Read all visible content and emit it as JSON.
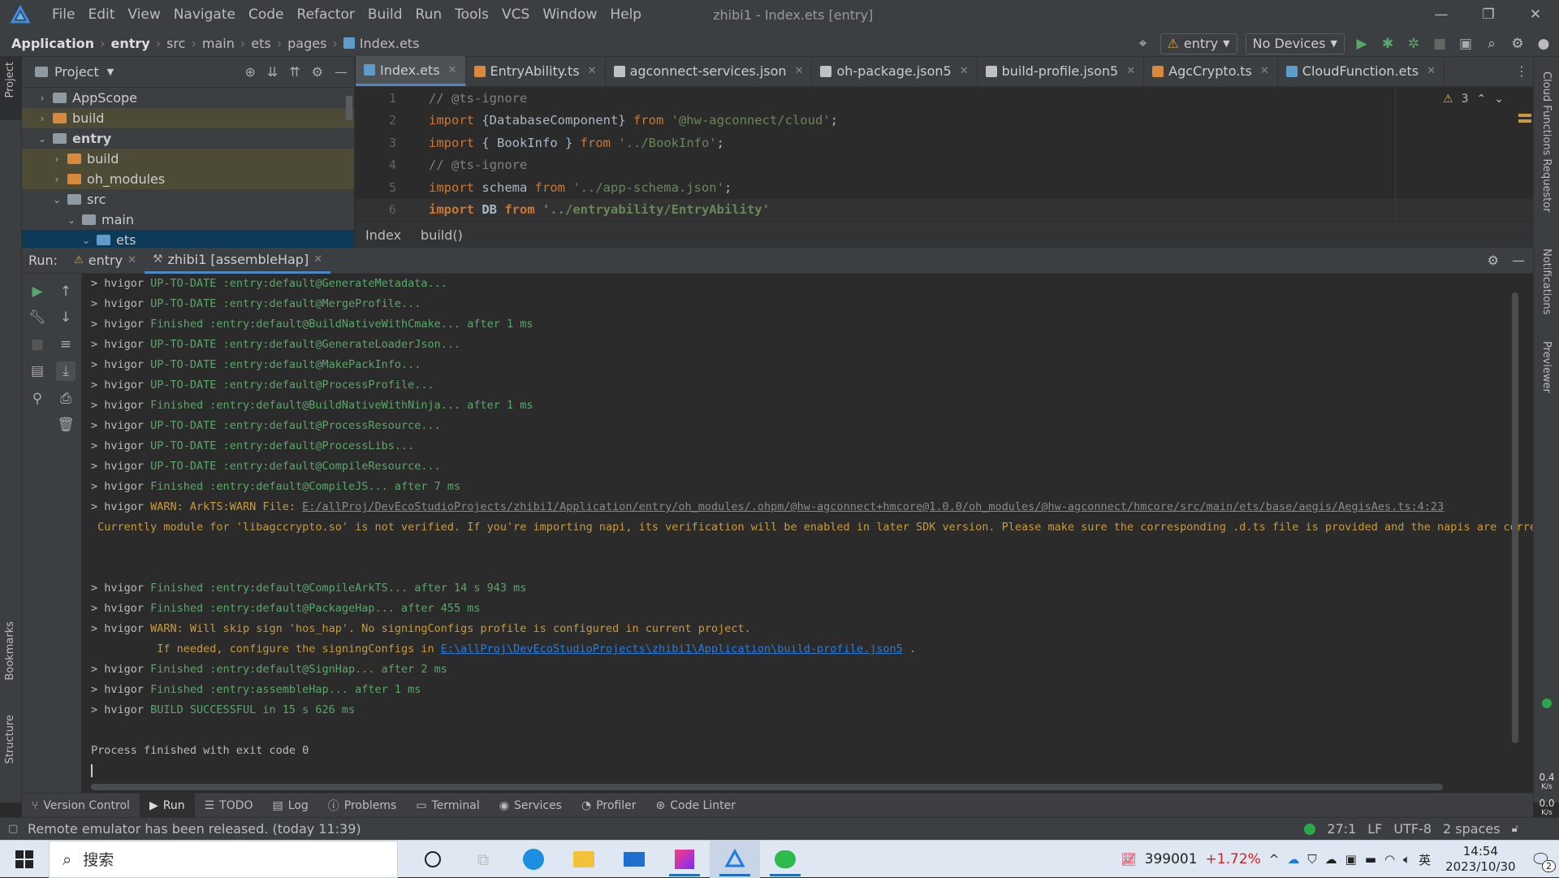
{
  "app": {
    "window_title": "zhibi1 - Index.ets [entry]",
    "menu": [
      "File",
      "Edit",
      "View",
      "Navigate",
      "Code",
      "Refactor",
      "Build",
      "Run",
      "Tools",
      "VCS",
      "Window",
      "Help"
    ]
  },
  "nav": {
    "breadcrumbs": [
      "Application",
      "entry",
      "src",
      "main",
      "ets",
      "pages",
      "Index.ets"
    ],
    "module_select": "entry",
    "device_select": "No Devices"
  },
  "project": {
    "title": "Project",
    "tree": [
      {
        "label": "AppScope",
        "depth": 1,
        "expanded": false,
        "color": "gray",
        "state": ""
      },
      {
        "label": "build",
        "depth": 1,
        "expanded": false,
        "color": "orange",
        "state": "hl"
      },
      {
        "label": "entry",
        "depth": 1,
        "expanded": true,
        "color": "gray",
        "state": "",
        "bold": true
      },
      {
        "label": "build",
        "depth": 2,
        "expanded": false,
        "color": "orange",
        "state": "hl"
      },
      {
        "label": "oh_modules",
        "depth": 2,
        "expanded": false,
        "color": "orange",
        "state": "hl"
      },
      {
        "label": "src",
        "depth": 2,
        "expanded": true,
        "color": "gray",
        "state": ""
      },
      {
        "label": "main",
        "depth": 3,
        "expanded": true,
        "color": "gray",
        "state": ""
      },
      {
        "label": "ets",
        "depth": 4,
        "expanded": true,
        "color": "blue",
        "state": "sel"
      }
    ]
  },
  "editor": {
    "tabs": [
      {
        "label": "Index.ets",
        "color": "#5e9ccb",
        "active": true
      },
      {
        "label": "EntryAbility.ts",
        "color": "#d9893b",
        "active": false
      },
      {
        "label": "agconnect-services.json",
        "color": "#c0c0c0",
        "active": false
      },
      {
        "label": "oh-package.json5",
        "color": "#c0c0c0",
        "active": false
      },
      {
        "label": "build-profile.json5",
        "color": "#c0c0c0",
        "active": false
      },
      {
        "label": "AgcCrypto.ts",
        "color": "#d9893b",
        "active": false
      },
      {
        "label": "CloudFunction.ets",
        "color": "#5e9ccb",
        "active": false
      }
    ],
    "warnings": "3",
    "lines": [
      {
        "n": "1",
        "text": "// @ts-ignore"
      },
      {
        "n": "2",
        "text": "import {DatabaseComponent} from '@hw-agconnect/cloud';"
      },
      {
        "n": "3",
        "text": "import { BookInfo } from '../BookInfo';"
      },
      {
        "n": "4",
        "text": "// @ts-ignore"
      },
      {
        "n": "5",
        "text": "import schema from '../app-schema.json';"
      },
      {
        "n": "6",
        "text": "import DB from '../entryability/EntryAbility'"
      }
    ],
    "code_crumbs": [
      "Index",
      "build()"
    ]
  },
  "run": {
    "label": "Run:",
    "tabs": [
      {
        "label": "entry",
        "active": false
      },
      {
        "label": "zhibi1 [assembleHap]",
        "active": true
      }
    ],
    "console": [
      {
        "p": "> hvigor ",
        "a": "UP-TO-DATE :entry:default@GenerateMetadata...",
        "c": "g"
      },
      {
        "p": "> hvigor ",
        "a": "UP-TO-DATE :entry:default@MergeProfile...",
        "c": "g"
      },
      {
        "p": "> hvigor ",
        "a": "Finished :entry:default@BuildNativeWithCmake... after 1 ms",
        "c": "g"
      },
      {
        "p": "> hvigor ",
        "a": "UP-TO-DATE :entry:default@GenerateLoaderJson...",
        "c": "g"
      },
      {
        "p": "> hvigor ",
        "a": "UP-TO-DATE :entry:default@MakePackInfo...",
        "c": "g"
      },
      {
        "p": "> hvigor ",
        "a": "UP-TO-DATE :entry:default@ProcessProfile...",
        "c": "g"
      },
      {
        "p": "> hvigor ",
        "a": "Finished :entry:default@BuildNativeWithNinja... after 1 ms",
        "c": "g"
      },
      {
        "p": "> hvigor ",
        "a": "UP-TO-DATE :entry:default@ProcessResource...",
        "c": "g"
      },
      {
        "p": "> hvigor ",
        "a": "UP-TO-DATE :entry:default@ProcessLibs...",
        "c": "g"
      },
      {
        "p": "> hvigor ",
        "a": "UP-TO-DATE :entry:default@CompileResource...",
        "c": "g"
      },
      {
        "p": "> hvigor ",
        "a": "Finished :entry:default@CompileJS... after 7 ms",
        "c": "g"
      }
    ],
    "warn1_prefix": "> hvigor ",
    "warn1_text": "WARN: ArkTS:WARN File: ",
    "warn1_link": "E:/allProj/DevEcoStudioProjects/zhibi1/Application/entry/oh_modules/.ohpm/@hw-agconnect+hmcore@1.0.0/oh_modules/@hw-agconnect/hmcore/src/main/ets/base/aegis/AegisAes.ts:4:23",
    "warn1_detail": " Currently module for 'libagccrypto.so' is not verified. If you're importing napi, its verification will be enabled in later SDK version. Please make sure the corresponding .d.ts file is provided and the napis are correctly",
    "console2": [
      {
        "p": "> hvigor ",
        "a": "Finished :entry:default@CompileArkTS... after 14 s 943 ms",
        "c": "g"
      },
      {
        "p": "> hvigor ",
        "a": "Finished :entry:default@PackageHap... after 455 ms",
        "c": "g"
      }
    ],
    "warn2_prefix": "> hvigor ",
    "warn2_text": "WARN: Will skip sign 'hos_hap'. No signingConfigs profile is configured in current project.",
    "warn2_detail": "          If needed, configure the signingConfigs in ",
    "warn2_link": "E:\\allProj\\DevEcoStudioProjects\\zhibi1\\Application\\build-profile.json5",
    "warn2_tail": " .",
    "console3": [
      {
        "p": "> hvigor ",
        "a": "Finished :entry:default@SignHap... after 2 ms",
        "c": "g"
      },
      {
        "p": "> hvigor ",
        "a": "Finished :entry:assembleHap... after 1 ms",
        "c": "g"
      },
      {
        "p": "> hvigor ",
        "a": "BUILD SUCCESSFUL in 15 s 626 ms",
        "c": "g"
      }
    ],
    "exit_line": "Process finished with exit code 0"
  },
  "bottom_tabs": [
    "Version Control",
    "Run",
    "TODO",
    "Log",
    "Problems",
    "Terminal",
    "Services",
    "Profiler",
    "Code Linter"
  ],
  "status": {
    "message": "Remote emulator has been released. (today 11:39)",
    "position": "27:1",
    "line_sep": "LF",
    "encoding": "UTF-8",
    "indent": "2 spaces"
  },
  "side_labels": {
    "left_top": "Project",
    "left_bookmarks": "Bookmarks",
    "left_structure": "Structure",
    "right_cloud": "Cloud Functions Requestor",
    "right_notifications": "Notifications",
    "right_previewer": "Previewer",
    "net_up": "0.4",
    "net_up_unit": "K/s",
    "net_down": "0.0",
    "net_down_unit": "K/s"
  },
  "taskbar": {
    "search_placeholder": "搜索",
    "stock_value": "399001",
    "stock_change": "+1.72%",
    "ime": "英",
    "time": "14:54",
    "date": "2023/10/30",
    "notif_count": "2"
  }
}
